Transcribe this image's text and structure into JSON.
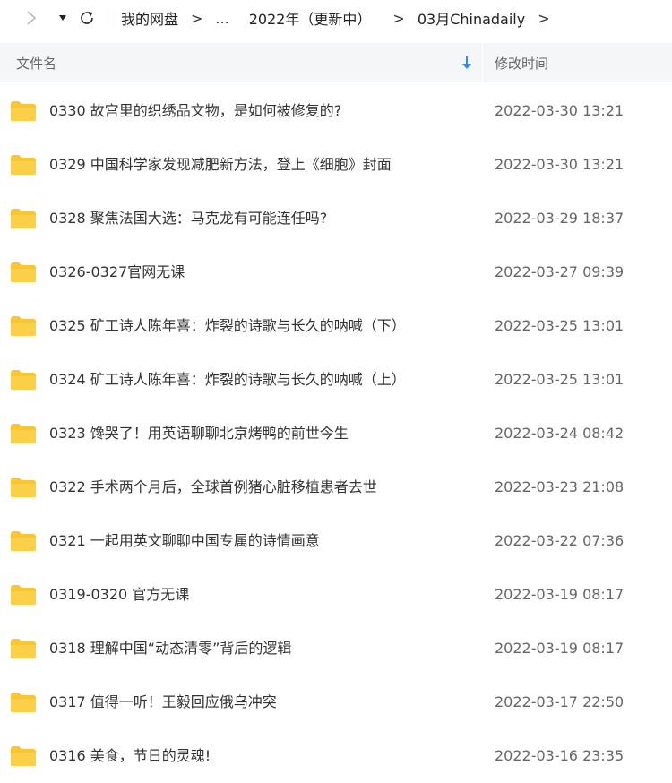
{
  "toolbar": {
    "forward_icon": "chevron-right-icon",
    "dropdown_icon": "caret-down-icon",
    "refresh_icon": "refresh-icon",
    "breadcrumb": [
      "我的网盘",
      "...",
      "2022年（更新中）",
      "03月Chinadaily"
    ],
    "separator": ">"
  },
  "header": {
    "name_label": "文件名",
    "time_label": "修改时间",
    "sort_icon": "sort-down-arrow-icon"
  },
  "colors": {
    "folder": "#f9c531",
    "sort_arrow": "#2b8ff1",
    "header_bg": "#f5f6f8",
    "text": "#333333",
    "muted": "#666666"
  },
  "files": [
    {
      "name": "0330 故宫里的织绣品文物，是如何被修复的?",
      "modified": "2022-03-30 13:21"
    },
    {
      "name": "0329 中国科学家发现减肥新方法，登上《细胞》封面",
      "modified": "2022-03-30 13:21"
    },
    {
      "name": "0328 聚焦法国大选：马克龙有可能连任吗?",
      "modified": "2022-03-29 18:37"
    },
    {
      "name": "0326-0327官网无课",
      "modified": "2022-03-27 09:39"
    },
    {
      "name": "0325 矿工诗人陈年喜：炸裂的诗歌与长久的呐喊（下）",
      "modified": "2022-03-25 13:01"
    },
    {
      "name": "0324 矿工诗人陈年喜：炸裂的诗歌与长久的呐喊（上）",
      "modified": "2022-03-25 13:01"
    },
    {
      "name": "0323 馋哭了！用英语聊聊北京烤鸭的前世今生",
      "modified": "2022-03-24 08:42"
    },
    {
      "name": "0322 手术两个月后，全球首例猪心脏移植患者去世",
      "modified": "2022-03-23 21:08"
    },
    {
      "name": "0321 一起用英文聊聊中国专属的诗情画意",
      "modified": "2022-03-22 07:36"
    },
    {
      "name": "0319-0320 官方无课",
      "modified": "2022-03-19 08:17"
    },
    {
      "name": "0318 理解中国“动态清零”背后的逻辑",
      "modified": "2022-03-19 08:17"
    },
    {
      "name": "0317 值得一听！王毅回应俄乌冲突",
      "modified": "2022-03-17 22:50"
    },
    {
      "name": "0316 美食，节日的灵魂!",
      "modified": "2022-03-16 23:35"
    }
  ]
}
